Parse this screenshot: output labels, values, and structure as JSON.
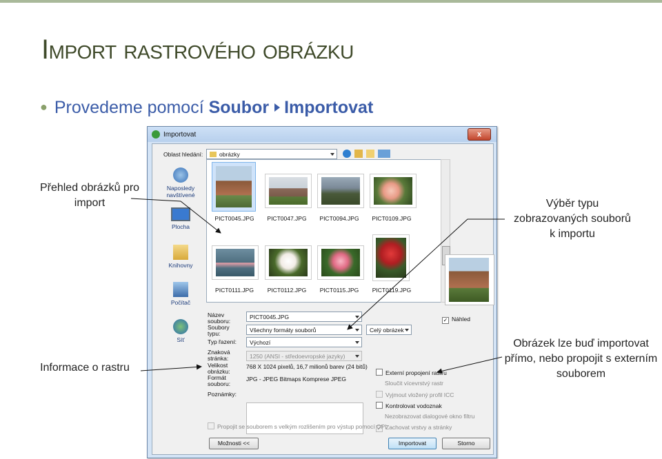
{
  "slide": {
    "title": "Import rastrového obrázku",
    "bullet_text": "Provedeme pomocí ",
    "bullet_menu1": "Soubor",
    "bullet_menu2": "Importovat"
  },
  "callouts": {
    "overview": "Přehled obrázků pro import",
    "file_type": "Výběr typu zobrazovaných souborů k importu",
    "raster_info": "Informace o rastru",
    "link_or_import": "Obrázek lze buď importovat přímo, nebo propojit s externím souborem"
  },
  "dialog": {
    "title": "Importovat",
    "close_glyph": "x",
    "look_in_label": "Oblast hledání:",
    "look_in_value": "obrázky",
    "places": [
      {
        "label": "Naposledy navštívené",
        "icon": "recent-places-icon"
      },
      {
        "label": "Plocha",
        "icon": "desktop-icon"
      },
      {
        "label": "Knihovny",
        "icon": "libraries-icon"
      },
      {
        "label": "Počítač",
        "icon": "computer-icon"
      },
      {
        "label": "Síť",
        "icon": "network-icon"
      }
    ],
    "files": [
      {
        "name": "PICT0045.JPG",
        "selected": true
      },
      {
        "name": "PICT0047.JPG",
        "selected": false
      },
      {
        "name": "PICT0094.JPG",
        "selected": false
      },
      {
        "name": "PICT0109.JPG",
        "selected": false
      },
      {
        "name": "PICT0111.JPG",
        "selected": false
      },
      {
        "name": "PICT0112.JPG",
        "selected": false
      },
      {
        "name": "PICT0115.JPG",
        "selected": false
      },
      {
        "name": "PICT0119.JPG",
        "selected": false
      }
    ],
    "filename_label": "Název souboru:",
    "filename_value": "PICT0045.JPG",
    "filetype_label": "Soubory typu:",
    "filetype_value": "Všechny formáty souborů",
    "crop_value": "Celý obrázek",
    "preview_label": "Náhled",
    "sort_label": "Typ řazení:",
    "sort_value": "Výchozí",
    "codepage_label": "Znaková stránka:",
    "codepage_value": "1250  (ANSI - středoevropské jazyky)",
    "size_label": "Velikost obrázku:",
    "size_value": "768 X 1024 pixelů, 16,7 milionů barev (24 bitů)",
    "format_label": "Formát souboru:",
    "format_value": "JPG - JPEG Bitmaps Komprese JPEG",
    "notes_label": "Poznámky:",
    "options": [
      {
        "label": "Externí propojení rastru",
        "checked": false,
        "enabled": true
      },
      {
        "label": "Sloučit vícevrstvý rastr",
        "checked": false,
        "enabled": false
      },
      {
        "label": "Vyjmout vložený profil ICC",
        "checked": false,
        "enabled": false
      },
      {
        "label": "Kontrolovat vodoznak",
        "checked": false,
        "enabled": true
      },
      {
        "label": "Nezobrazovat dialogové okno filtru",
        "checked": false,
        "enabled": false
      },
      {
        "label": "Zachovat vrstvy a stránky",
        "checked": true,
        "enabled": false
      }
    ],
    "hires_label": "Propojit se souborem s velkým rozlišením pro výstup pomocí OPI",
    "more_button": "Možnosti <<",
    "import_button": "Importovat",
    "cancel_button": "Storno"
  }
}
